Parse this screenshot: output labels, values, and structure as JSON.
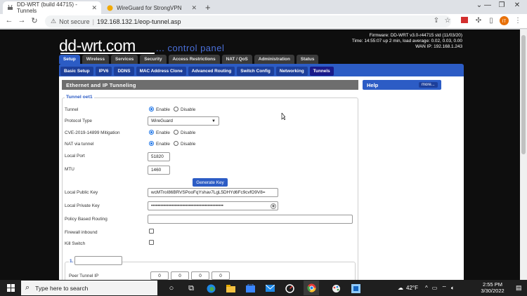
{
  "browser": {
    "tabs": [
      {
        "title": "DD-WRT (build 44715) - Tunnels",
        "active": true
      },
      {
        "title": "WireGuard for StrongVPN",
        "active": false
      }
    ],
    "new_tab": "+",
    "not_secure": "Not secure",
    "url": "192.168.132.1/eop-tunnel.asp",
    "profile_initial": "IT",
    "window_controls": {
      "minimize": "—",
      "maximize": "❐",
      "close": "✕"
    }
  },
  "header": {
    "logo": "dd-wrt.com",
    "tagline": "... control panel",
    "firmware": "Firmware: DD-WRT v3.0-r44715 std (11/03/20)",
    "time": "Time: 14:55:07 up 2 min, load average: 0.02, 0.03, 0.00",
    "wan_ip": "WAN IP: 192.168.1.243"
  },
  "top_nav": [
    {
      "label": "Setup",
      "active": true
    },
    {
      "label": "Wireless"
    },
    {
      "label": "Services"
    },
    {
      "label": "Security"
    },
    {
      "label": "Access Restrictions"
    },
    {
      "label": "NAT / QoS"
    },
    {
      "label": "Administration"
    },
    {
      "label": "Status"
    }
  ],
  "sub_nav": [
    {
      "label": "Basic Setup"
    },
    {
      "label": "IPV6"
    },
    {
      "label": "DDNS"
    },
    {
      "label": "MAC Address Clone"
    },
    {
      "label": "Advanced Routing"
    },
    {
      "label": "Switch Config"
    },
    {
      "label": "Networking"
    },
    {
      "label": "Tunnels",
      "active": true
    }
  ],
  "main": {
    "section_title": "Ethernet and IP Tunneling",
    "legend": "Tunnel oet1",
    "fields": {
      "tunnel": {
        "label": "Tunnel",
        "enable": "Enable",
        "disable": "Disable",
        "selected": "Enable"
      },
      "protocol": {
        "label": "Protocol Type",
        "value": "WireGuard"
      },
      "cve": {
        "label": "CVE-2019-14899 Mitigation",
        "enable": "Enable",
        "disable": "Disable",
        "selected": "Enable"
      },
      "nat": {
        "label": "NAT via tunnel",
        "enable": "Enable",
        "disable": "Disable",
        "selected": "Enable"
      },
      "local_port": {
        "label": "Local Port",
        "value": "51820"
      },
      "mtu": {
        "label": "MTU",
        "value": "1460"
      },
      "generate_key": "Generate Key",
      "public_key": {
        "label": "Local Public Key",
        "value": "wcMTroI86BRVSPooFqYshav7LgL5DHYd6Fc9cvfO9V8="
      },
      "private_key": {
        "label": "Local Private Key",
        "value": "••••••••••••••••••••••••••••••••••••••••••••••"
      },
      "policy_routing": {
        "label": "Policy Based Routing",
        "value": ""
      },
      "firewall_inbound": {
        "label": "Firewall inbound",
        "checked": false
      },
      "kill_switch": {
        "label": "Kill Switch",
        "checked": false
      }
    },
    "peer": {
      "number": "1.",
      "name_value": "",
      "peer_tunnel_ip_label": "Peer Tunnel IP",
      "ip_octets": [
        "0",
        "0",
        "0",
        "0"
      ]
    }
  },
  "help": {
    "title": "Help",
    "more": "more..."
  },
  "taskbar": {
    "search_placeholder": "Type here to search",
    "weather": "42°F",
    "time": "2:55 PM",
    "date": "3/30/2022"
  },
  "colors": {
    "nav_blue": "#2c5cc5",
    "section_gray": "#6e6e6e",
    "page_bg": "#0e0e0e"
  }
}
